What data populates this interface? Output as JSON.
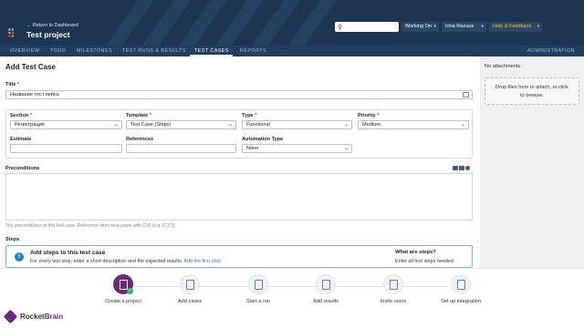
{
  "header": {
    "return_link": "← Return to Dashboard",
    "project_title": "Test project",
    "search_placeholder": "",
    "working_on": "Working On",
    "user_name": "Irina Reeuue",
    "help": "Help & Feedback",
    "caret": "▾",
    "logo_colors": [
      "#3fa9f5",
      "#7ac943",
      "#f7931e",
      "#ed1c24"
    ]
  },
  "tabs": {
    "overview": "OVERVIEW",
    "todo": "TODO",
    "milestones": "MILESTONES",
    "test_runs": "TEST RUNS & RESULTS",
    "test_cases": "TEST CASES",
    "reports": "REPORTS",
    "administration": "ADMINISTRATION",
    "active": "TEST CASES"
  },
  "form": {
    "page_title": "Add Test Case",
    "title_label": "Title",
    "title_value": "Название тест кейса",
    "required_mark": "*",
    "section_label": "Section",
    "section_value": "Регистрация",
    "template_label": "Template",
    "template_value": "Test Case (Steps)",
    "type_label": "Type",
    "type_value": "Functional",
    "priority_label": "Priority",
    "priority_value": "Medium",
    "estimate_label": "Estimate",
    "estimate_value": "",
    "references_label": "References",
    "references_value": "",
    "automation_label": "Automation Type",
    "automation_value": "None",
    "preconditions_label": "Preconditions",
    "preconditions_hint": "The preconditions of this test case. Reference other test cases with [C#] (e.g. [C17]).",
    "steps_label": "Steps"
  },
  "steps_panel": {
    "info_icon": "i",
    "heading": "Add steps to this test case",
    "description": "For every test step, enter a short description and the expected results.",
    "link": "Add the first step.",
    "what_heading": "What are steps?",
    "what_text": "Enter all test steps needed"
  },
  "sidebar": {
    "no_attachments": "No attachments.",
    "dropzone_line1": "Drop files here to attach, or click",
    "dropzone_line2": "to browse."
  },
  "onboarding": {
    "steps": [
      {
        "label": "Create a project",
        "done": true
      },
      {
        "label": "Add cases",
        "done": false
      },
      {
        "label": "Start a run",
        "done": false
      },
      {
        "label": "Add results",
        "done": false
      },
      {
        "label": "Invite users",
        "done": false
      },
      {
        "label": "Set up integration",
        "done": false
      }
    ],
    "check": "✓",
    "brand_prefix": "Rocket",
    "brand_suffix": "Brain",
    "accent_color": "#6b2a7a"
  }
}
